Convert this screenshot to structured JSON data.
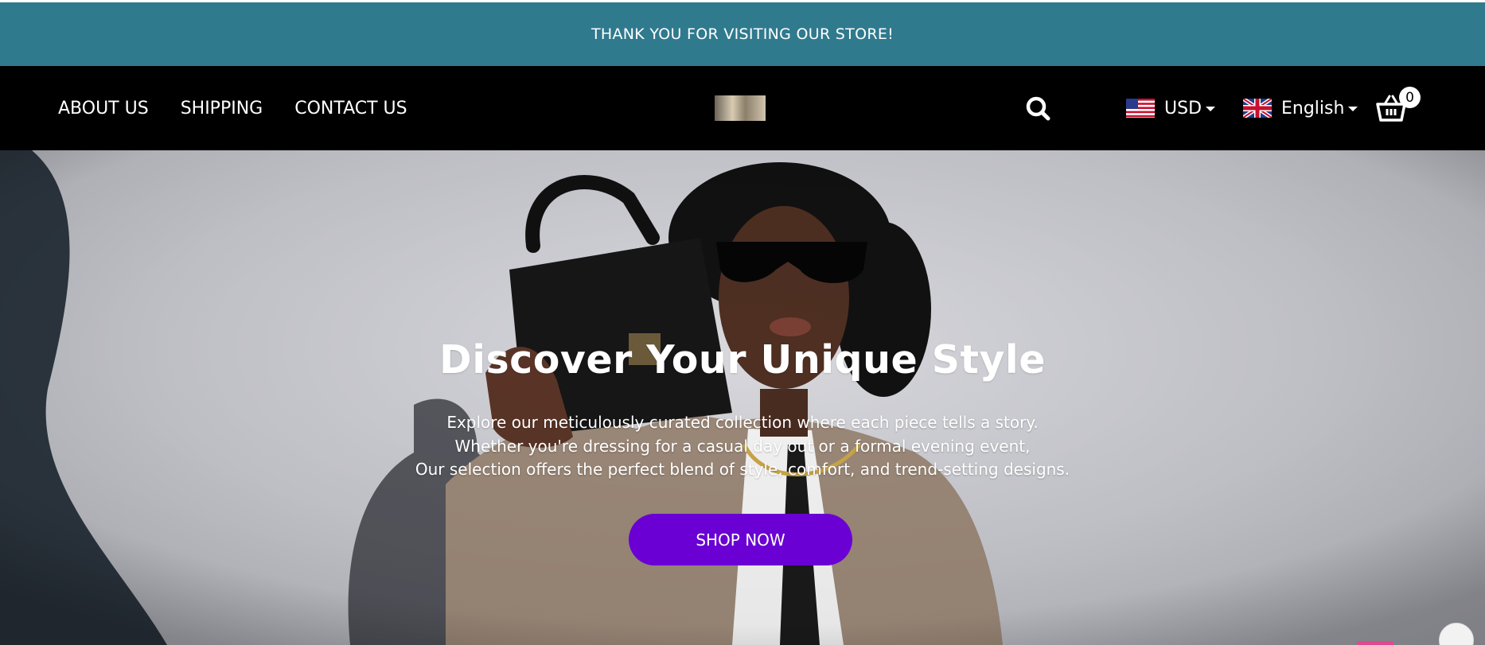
{
  "announcement": "THANK YOU FOR VISITING OUR STORE!",
  "nav": {
    "about": "ABOUT US",
    "shipping": "SHIPPING",
    "contact": "CONTACT US"
  },
  "header": {
    "currency": "USD",
    "language": "English",
    "cart_count": "0"
  },
  "hero": {
    "title": "Discover Your Unique Style",
    "line1": "Explore our meticulously curated collection where each piece tells a story.",
    "line2": "Whether you're dressing for a casual day out or a formal evening event,",
    "line3": "Our selection offers the perfect blend of style, comfort, and trend-setting designs.",
    "cta": "SHOP NOW"
  },
  "colors": {
    "announcement_bg": "#307a8e",
    "header_bg": "#000000",
    "cta_bg": "#6a00d4"
  },
  "icons": [
    "search-icon",
    "us-flag-icon",
    "uk-flag-icon",
    "cart-icon",
    "caret-down-icon"
  ]
}
